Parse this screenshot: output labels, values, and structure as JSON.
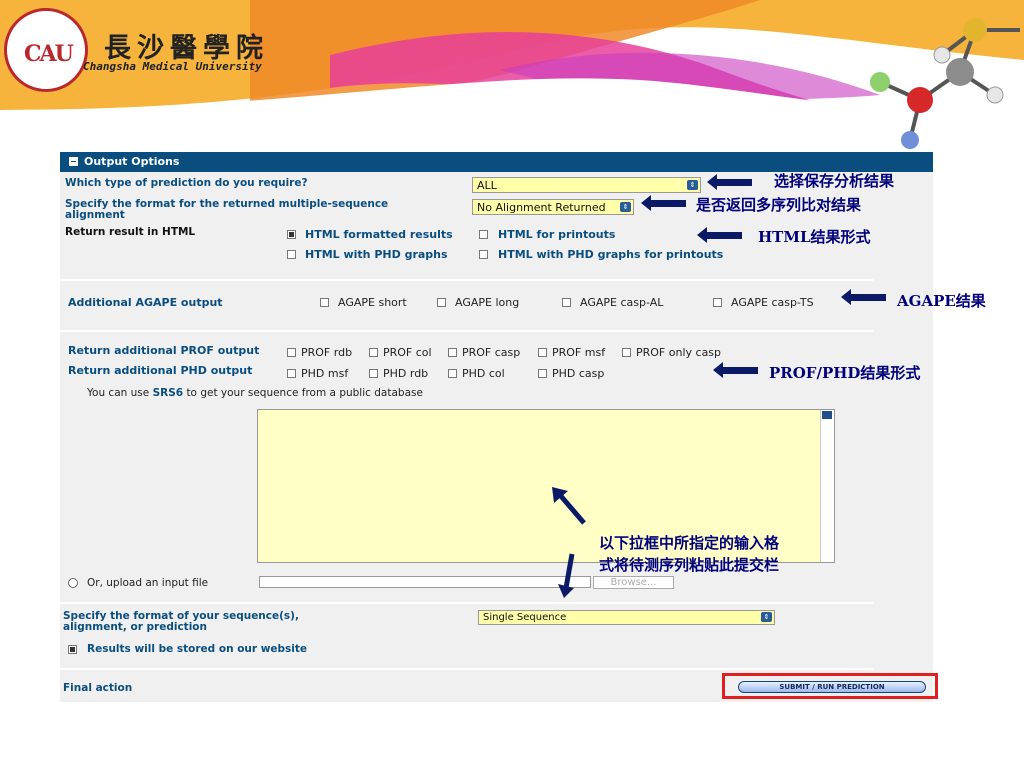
{
  "header": {
    "logo_text": "CAU",
    "school_name_cn": "長沙醫學院",
    "school_name_en": "Changsha Medical University"
  },
  "panel": {
    "title": "Output Options",
    "prediction": {
      "label": "Which type of prediction do you require?",
      "value": "ALL"
    },
    "alignment": {
      "label": "Specify the format for the returned multiple-sequence alignment",
      "value": "No Alignment Returned"
    },
    "html": {
      "label": "Return result in HTML",
      "options": [
        {
          "label": "HTML formatted results",
          "checked": true
        },
        {
          "label": "HTML for printouts",
          "checked": false
        },
        {
          "label": "HTML with PHD graphs",
          "checked": false
        },
        {
          "label": "HTML with PHD graphs for printouts",
          "checked": false
        }
      ]
    },
    "agape": {
      "label": "Additional AGAPE output",
      "options": [
        "AGAPE short",
        "AGAPE long",
        "AGAPE casp-AL",
        "AGAPE casp-TS"
      ]
    },
    "prof": {
      "label": "Return additional PROF output",
      "options": [
        "PROF rdb",
        "PROF col",
        "PROF casp",
        "PROF msf",
        "PROF only casp"
      ]
    },
    "phd": {
      "label": "Return additional PHD output",
      "options": [
        "PHD msf",
        "PHD rdb",
        "PHD col",
        "PHD casp"
      ]
    },
    "srs": {
      "prefix": "You can use",
      "link": "SRS6",
      "suffix": "to get your sequence from a public database"
    },
    "upload": {
      "label": "Or, upload an input file",
      "browse": "Browse..."
    },
    "format": {
      "label": "Specify the format of your sequence(s), alignment, or prediction",
      "value": "Single Sequence"
    },
    "store": {
      "label": "Results will be stored on our website",
      "checked": true
    },
    "final": {
      "label": "Final action",
      "submit": "SUBMIT / RUN PREDICTION"
    }
  },
  "annotations": {
    "a1": "选择保存分析结果",
    "a2": "是否返回多序列比对结果",
    "a3": "HTML结果形式",
    "a4": "AGAPE结果",
    "a5": "PROF/PHD结果形式",
    "a6_line1": "以下拉框中所指定的输入格",
    "a6_line2": "式将待测序列粘贴此提交栏"
  },
  "colors": {
    "panel_header": "#0a4e80",
    "input_bg": "#ffffaa",
    "annotation": "#00007a",
    "highlight": "#e02020"
  }
}
